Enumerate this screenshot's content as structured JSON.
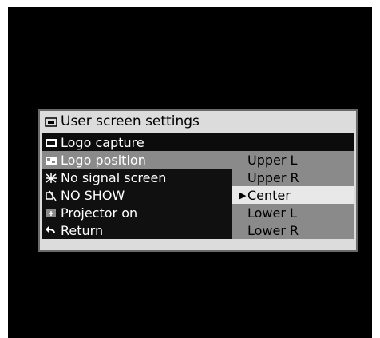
{
  "menu": {
    "title": "User screen settings",
    "title_icon": "user-screen-icon",
    "items": [
      {
        "label": "Logo capture",
        "icon": "logo-capture-icon"
      },
      {
        "label": "Logo position",
        "icon": "logo-position-icon"
      },
      {
        "label": "No signal screen",
        "icon": "no-signal-icon"
      },
      {
        "label": "NO SHOW",
        "icon": "no-show-icon"
      },
      {
        "label": "Projector on",
        "icon": "projector-on-icon"
      },
      {
        "label": "Return",
        "icon": "return-icon"
      }
    ]
  },
  "position_options": {
    "items": [
      "Upper L",
      "Upper R",
      "Center",
      "Lower L",
      "Lower R"
    ],
    "selected": "Center",
    "selected_marker": "▶"
  },
  "colors": {
    "background": "#000000",
    "menu_bg": "#dcdcdc",
    "highlight": "#e8e8e8",
    "item_dark": "#101010",
    "item_gray": "#8a8a8a"
  }
}
